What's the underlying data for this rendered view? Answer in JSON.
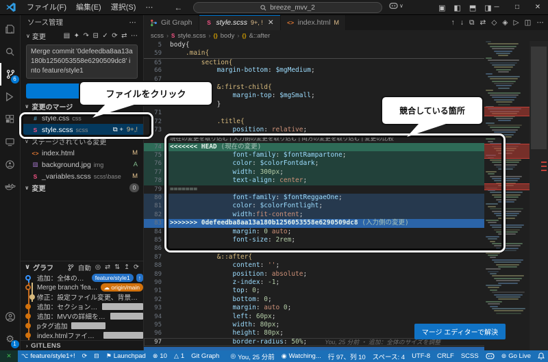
{
  "colors": {
    "accent": "#0078d4",
    "status_bg": "#1c70b8",
    "selected_row": "#04395e",
    "modified_badge": "#e2c08d",
    "added_badge": "#81b88b",
    "scss_pink": "#f55385",
    "css_blue": "#519aba",
    "html_orange": "#e37933",
    "img_purple": "#a074c4",
    "conflict_current_bg": "#2e6b57",
    "conflict_incoming_bg": "#2b64a8",
    "pill_blue": "#2472c8",
    "pill_orange": "#d1710c"
  },
  "titlebar": {
    "menus": [
      "ファイル(F)",
      "編集(E)",
      "選択(S)",
      "⋯"
    ],
    "search_value": "breeze_mvv_2",
    "window_controls": [
      "─",
      "□",
      "✕"
    ]
  },
  "activity_bar": {
    "scm_badge": "6",
    "settings_badge": "1"
  },
  "sidebar": {
    "title": "ソース管理",
    "view_label": "変更",
    "commit_message": "Merge commit '0defeedba8aa13a180b1256053558e6290509dc8' into feature/style1",
    "merge_section": "変更のマージ",
    "merge_files": [
      {
        "icon": "#",
        "color": "#519aba",
        "name": "style.css",
        "path": "css",
        "status": "",
        "status_color": "#e2c08d",
        "selected": false
      },
      {
        "icon": "S",
        "color": "#f55385",
        "name": "style.scss",
        "path": "scss",
        "row_icons": "⧉ +",
        "status": "9+,!",
        "status_color": "#e2c08d",
        "selected": true
      }
    ],
    "staged_section": "ステージされている変更",
    "staged_files": [
      {
        "icon": "<>",
        "color": "#e37933",
        "name": "index.html",
        "path": "",
        "status": "M",
        "status_color": "#e2c08d"
      },
      {
        "icon": "▨",
        "color": "#a074c4",
        "name": "background.jpg",
        "path": "img",
        "status": "A",
        "status_color": "#81b88b"
      },
      {
        "icon": "S",
        "color": "#f55385",
        "name": "_variables.scss",
        "path": "scss\\base",
        "status": "M",
        "status_color": "#e2c08d"
      }
    ],
    "changes_section": "変更",
    "changes_badge": "0",
    "graph": {
      "title": "グラフ",
      "auto_label": "自動",
      "commits": [
        {
          "msg": "追加：全体のサイ...",
          "pill": "feature/style1",
          "pill_color": "blue",
          "extra": "↑",
          "dot": "blue-ring"
        },
        {
          "msg": "Merge branch 'featur...",
          "pill": "origin/main",
          "pill_color": "orange",
          "pill_icon": "☁",
          "dot": "orange-ring"
        },
        {
          "msg": "修正：設定ファイル変更、背景色変更...",
          "dot": "yellow"
        },
        {
          "msg": "追加：セクション追加",
          "redact": 60,
          "dot": "orange"
        },
        {
          "msg": "追加：MVVの詳細を追加",
          "redact": 48,
          "dot": "orange"
        },
        {
          "msg": "pタグ追加",
          "redact": 50,
          "dot": "orange"
        },
        {
          "msg": "index.htmlファイル作成",
          "redact": 58,
          "dot": "orange"
        }
      ]
    },
    "gitlens_label": "GITLENS"
  },
  "editor": {
    "tabs": [
      {
        "label": "Git Graph",
        "icon": "git-graph",
        "mod": "",
        "active": false,
        "italic": false
      },
      {
        "label": "style.scss",
        "icon": "sass",
        "mod": "9+, !",
        "close": "✕",
        "active": true,
        "italic": true
      },
      {
        "label": "index.html",
        "icon": "html",
        "mod": "M",
        "active": false,
        "italic": false
      }
    ],
    "breadcrumb": [
      {
        "label": "scss",
        "icon": ""
      },
      {
        "label": "style.scss",
        "icon": "S",
        "icon_color": "#f55385"
      },
      {
        "label": "body",
        "icon": "{}",
        "icon_color": "#d7a100"
      },
      {
        "label": "&::after",
        "icon": "{}",
        "icon_color": "#d7a100"
      }
    ],
    "codelens": "現在の変更を取り込む | 入力側の変更を取り込む | 両方の変更を取り込む | 変更の比較",
    "blame": "You, 25 分前 ・ 追加：全体のサイズを調整",
    "merge_button": "マージ エディターで解決",
    "code": [
      {
        "n": "5",
        "t": [
          [
            "body{",
            "w"
          ]
        ]
      },
      {
        "n": "59",
        "t": [
          [
            "    ",
            "w"
          ],
          [
            ".main{",
            "s"
          ]
        ]
      },
      {
        "n": "65",
        "c": "fold",
        "t": [
          [
            "        ",
            "w"
          ],
          [
            "section{",
            "s"
          ]
        ]
      },
      {
        "n": "66",
        "t": [
          [
            "            ",
            "w"
          ],
          [
            "margin-bottom",
            "p"
          ],
          [
            ": ",
            "w"
          ],
          [
            "$mgMedium",
            "v"
          ],
          [
            ";",
            "w"
          ]
        ]
      },
      {
        "n": "67",
        "t": []
      },
      {
        "n": "68",
        "t": [
          [
            "            ",
            "w"
          ],
          [
            "&:first-child{",
            "s"
          ]
        ]
      },
      {
        "n": "69",
        "t": [
          [
            "                ",
            "w"
          ],
          [
            "margin-top",
            "p"
          ],
          [
            ": ",
            "w"
          ],
          [
            "$mgSmall",
            "v"
          ],
          [
            ";",
            "w"
          ]
        ]
      },
      {
        "n": "70",
        "t": [
          [
            "            ",
            "w"
          ],
          [
            "}",
            "w"
          ]
        ]
      },
      {
        "n": "71",
        "t": []
      },
      {
        "n": "72",
        "t": [
          [
            "            ",
            "w"
          ],
          [
            ".title{",
            "s"
          ]
        ]
      },
      {
        "n": "73",
        "t": [
          [
            "                ",
            "w"
          ],
          [
            "position",
            "p"
          ],
          [
            ": ",
            "w"
          ],
          [
            "relative",
            "k"
          ],
          [
            ";",
            "w"
          ]
        ]
      },
      {
        "lens": true
      },
      {
        "n": "74",
        "c": "gh",
        "t": [
          [
            "<<<<<<< HEAD",
            "mh"
          ],
          [
            " (現在の変更)",
            "mg"
          ]
        ]
      },
      {
        "n": "75",
        "c": "g",
        "t": [
          [
            "                ",
            "w"
          ],
          [
            "font-family",
            "p"
          ],
          [
            ": ",
            "w"
          ],
          [
            "$fontRampartone",
            "v"
          ],
          [
            ";",
            "w"
          ]
        ]
      },
      {
        "n": "76",
        "c": "g",
        "t": [
          [
            "                ",
            "w"
          ],
          [
            "color",
            "p"
          ],
          [
            ": ",
            "w"
          ],
          [
            "$colorFontdark",
            "v"
          ],
          [
            ";",
            "w"
          ]
        ]
      },
      {
        "n": "77",
        "c": "g",
        "t": [
          [
            "                ",
            "w"
          ],
          [
            "width",
            "p"
          ],
          [
            ": ",
            "w"
          ],
          [
            "300px",
            "n"
          ],
          [
            ";",
            "w"
          ]
        ]
      },
      {
        "n": "78",
        "c": "g",
        "t": [
          [
            "                ",
            "w"
          ],
          [
            "text-align",
            "p"
          ],
          [
            ": ",
            "w"
          ],
          [
            "center",
            "k"
          ],
          [
            ";",
            "w"
          ]
        ]
      },
      {
        "n": "79",
        "t": [
          [
            "=======",
            "mm"
          ]
        ]
      },
      {
        "n": "80",
        "c": "b",
        "t": [
          [
            "                ",
            "w"
          ],
          [
            "font-family",
            "p"
          ],
          [
            ": ",
            "w"
          ],
          [
            "$fontReggaeOne",
            "v"
          ],
          [
            ";",
            "w"
          ]
        ]
      },
      {
        "n": "81",
        "c": "b",
        "t": [
          [
            "                ",
            "w"
          ],
          [
            "color",
            "p"
          ],
          [
            ": ",
            "w"
          ],
          [
            "$colorFontlight",
            "v"
          ],
          [
            ";",
            "w"
          ]
        ]
      },
      {
        "n": "82",
        "c": "b",
        "t": [
          [
            "                ",
            "w"
          ],
          [
            "width",
            "p"
          ],
          [
            ":",
            "w"
          ],
          [
            "fit-content",
            "k"
          ],
          [
            ";",
            "w"
          ]
        ]
      },
      {
        "n": "83",
        "c": "bh",
        "t": [
          [
            ">>>>>>> 0defeedba8aa13a180b1256053558e6290509dc8",
            "mh"
          ],
          [
            " (入力側の変更)",
            "mg"
          ]
        ]
      },
      {
        "n": "84",
        "t": [
          [
            "                ",
            "w"
          ],
          [
            "margin",
            "p"
          ],
          [
            ": ",
            "w"
          ],
          [
            "0",
            "n"
          ],
          [
            " ",
            "w"
          ],
          [
            "auto",
            "k"
          ],
          [
            ";",
            "w"
          ]
        ]
      },
      {
        "n": "85",
        "t": [
          [
            "                ",
            "w"
          ],
          [
            "font-size",
            "p"
          ],
          [
            ": ",
            "w"
          ],
          [
            "2rem",
            "n"
          ],
          [
            ";",
            "w"
          ]
        ]
      },
      {
        "n": "86",
        "t": []
      },
      {
        "n": "87",
        "t": [
          [
            "            ",
            "w"
          ],
          [
            "&::after{",
            "s"
          ]
        ]
      },
      {
        "n": "88",
        "t": [
          [
            "                ",
            "w"
          ],
          [
            "content",
            "p"
          ],
          [
            ": ",
            "w"
          ],
          [
            "''",
            "k"
          ],
          [
            ";",
            "w"
          ]
        ]
      },
      {
        "n": "89",
        "t": [
          [
            "                ",
            "w"
          ],
          [
            "position",
            "p"
          ],
          [
            ": ",
            "w"
          ],
          [
            "absolute",
            "k"
          ],
          [
            ";",
            "w"
          ]
        ]
      },
      {
        "n": "90",
        "t": [
          [
            "                ",
            "w"
          ],
          [
            "z-index",
            "p"
          ],
          [
            ": ",
            "w"
          ],
          [
            "-1",
            "n"
          ],
          [
            ";",
            "w"
          ]
        ]
      },
      {
        "n": "91",
        "t": [
          [
            "                ",
            "w"
          ],
          [
            "top",
            "p"
          ],
          [
            ": ",
            "w"
          ],
          [
            "0",
            "n"
          ],
          [
            ";",
            "w"
          ]
        ]
      },
      {
        "n": "92",
        "t": [
          [
            "                ",
            "w"
          ],
          [
            "bottom",
            "p"
          ],
          [
            ": ",
            "w"
          ],
          [
            "0",
            "n"
          ],
          [
            ";",
            "w"
          ]
        ]
      },
      {
        "n": "93",
        "t": [
          [
            "                ",
            "w"
          ],
          [
            "margin",
            "p"
          ],
          [
            ": ",
            "w"
          ],
          [
            "auto",
            "k"
          ],
          [
            " ",
            "w"
          ],
          [
            "0",
            "n"
          ],
          [
            ";",
            "w"
          ]
        ]
      },
      {
        "n": "94",
        "t": [
          [
            "                ",
            "w"
          ],
          [
            "left",
            "p"
          ],
          [
            ": ",
            "w"
          ],
          [
            "60px",
            "n"
          ],
          [
            ";",
            "w"
          ]
        ]
      },
      {
        "n": "95",
        "t": [
          [
            "                ",
            "w"
          ],
          [
            "width",
            "p"
          ],
          [
            ": ",
            "w"
          ],
          [
            "80px",
            "n"
          ],
          [
            ";",
            "w"
          ]
        ]
      },
      {
        "n": "96",
        "t": [
          [
            "                ",
            "w"
          ],
          [
            "height",
            "p"
          ],
          [
            ": ",
            "w"
          ],
          [
            "80px",
            "n"
          ],
          [
            ";",
            "w"
          ]
        ]
      },
      {
        "n": "97",
        "c": "cur",
        "blame": true,
        "t": [
          [
            "                ",
            "w"
          ],
          [
            "border-radius",
            "p"
          ],
          [
            ": ",
            "w"
          ],
          [
            "50%",
            "n"
          ],
          [
            ";",
            "w"
          ]
        ]
      }
    ]
  },
  "annotations": {
    "file_callout": "ファイルをクリック",
    "conflict_callout": "競合している箇所"
  },
  "status_bar": {
    "left": [
      {
        "icon": "branch",
        "text": "feature/style1+!"
      },
      {
        "icon": "sync",
        "text": ""
      },
      {
        "icon": "layers",
        "text": ""
      },
      {
        "icon": "launchpad",
        "text": "Launchpad"
      },
      {
        "icon": "error",
        "text": "10"
      },
      {
        "icon": "warning",
        "text": "1"
      },
      {
        "icon": "",
        "text": "Git Graph"
      }
    ],
    "right": [
      {
        "icon": "commit",
        "text": "You, 25 分前"
      },
      {
        "icon": "watch",
        "text": "Watching..."
      },
      {
        "icon": "",
        "text": "行 97、列 10"
      },
      {
        "icon": "",
        "text": "スペース: 4"
      },
      {
        "icon": "",
        "text": "UTF-8"
      },
      {
        "icon": "",
        "text": "CRLF"
      },
      {
        "icon": "",
        "text": "SCSS"
      },
      {
        "icon": "copilot",
        "text": ""
      },
      {
        "icon": "broadcast",
        "text": "Go Live"
      },
      {
        "icon": "bell",
        "text": ""
      }
    ]
  }
}
